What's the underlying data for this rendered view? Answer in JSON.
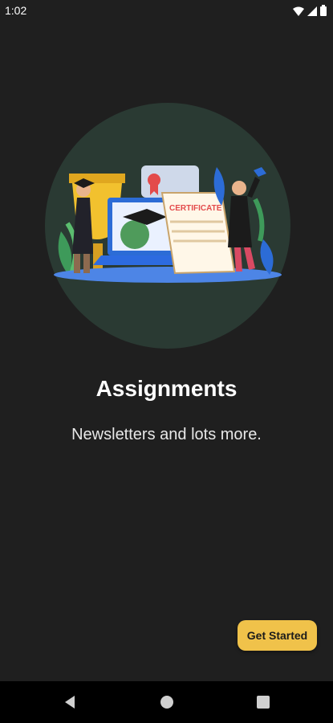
{
  "status_bar": {
    "time": "1:02",
    "icons": [
      "wifi-icon",
      "signal-icon",
      "battery-icon"
    ]
  },
  "onboarding": {
    "illustration": "graduation-certificate-illustration",
    "illustration_text": "CERTIFICATE",
    "title": "Assignments",
    "subtitle": "Newsletters and lots more.",
    "cta_label": "Get Started"
  },
  "navigation_bar": {
    "buttons": [
      "back-icon",
      "home-icon",
      "recents-icon"
    ]
  },
  "colors": {
    "background": "#1f1f1f",
    "cta": "#f0c24a",
    "illustration_circle": "#2a3a33"
  }
}
